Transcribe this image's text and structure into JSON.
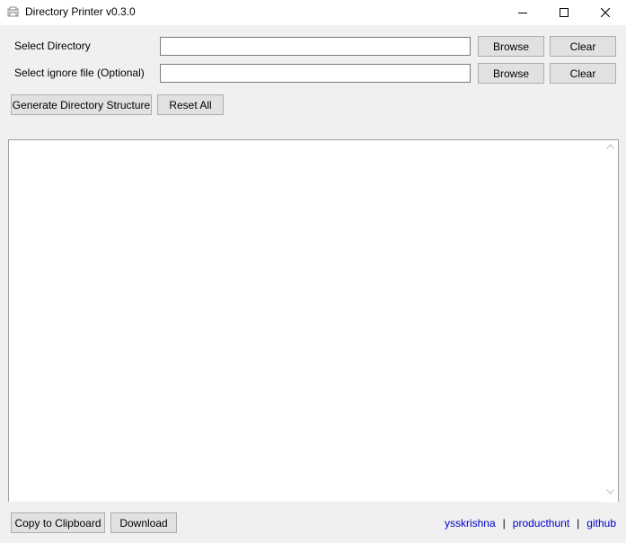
{
  "window": {
    "title": "Directory Printer v0.3.0"
  },
  "form": {
    "directory": {
      "label": "Select Directory",
      "value": "",
      "browse_label": "Browse",
      "clear_label": "Clear"
    },
    "ignore_file": {
      "label": "Select ignore file (Optional)",
      "value": "",
      "browse_label": "Browse",
      "clear_label": "Clear"
    }
  },
  "actions": {
    "generate_label": "Generate Directory Structure",
    "reset_label": "Reset All"
  },
  "output": {
    "text": ""
  },
  "footer": {
    "copy_label": "Copy to Clipboard",
    "download_label": "Download",
    "links": [
      {
        "label": "ysskrishna"
      },
      {
        "label": "producthunt"
      },
      {
        "label": "github"
      }
    ],
    "separator": "|"
  },
  "icons": [
    "app-icon",
    "minimize-icon",
    "maximize-icon",
    "close-icon",
    "scroll-up-icon",
    "scroll-down-icon"
  ]
}
